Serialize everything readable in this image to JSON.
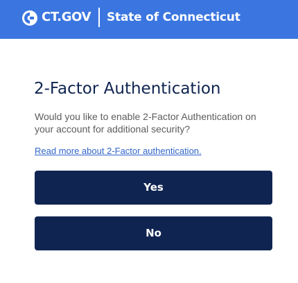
{
  "header": {
    "logo_icon": "ct-gov-logo-icon",
    "brand_name": "CT.GOV",
    "state_name": "State of Connecticut",
    "background_color": "#3b76e0"
  },
  "dialog": {
    "title": "2-Factor Authentication",
    "description": "Would you like to enable 2-Factor Authentication on your account for additional security?",
    "link_text": "Read more about 2-Factor authentication.",
    "yes_label": "Yes",
    "no_label": "No",
    "button_color": "#0f2450",
    "link_color": "#3065c9"
  }
}
